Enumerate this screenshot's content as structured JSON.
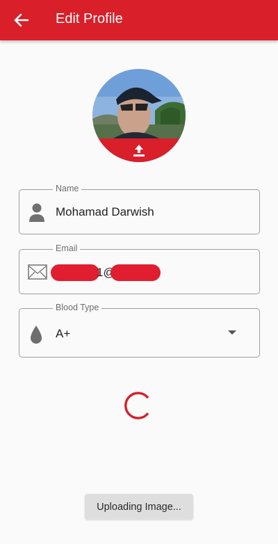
{
  "appbar": {
    "title": "Edit Profile",
    "back_icon": "arrow-back-icon"
  },
  "avatar": {
    "upload_icon": "upload-icon"
  },
  "fields": {
    "name": {
      "label": "Name",
      "value": "Mohamad Darwish",
      "icon": "person-icon"
    },
    "email": {
      "label": "Email",
      "value_visible_part": "1@",
      "icon": "mail-icon"
    },
    "blood_type": {
      "label": "Blood Type",
      "value": "A+",
      "icon": "blood-drop-icon",
      "dropdown_icon": "caret-down-icon"
    }
  },
  "status": {
    "spinner_icon": "loading-spinner"
  },
  "button": {
    "label": "Uploading Image..."
  },
  "colors": {
    "primary": "#d81f2a",
    "background": "#fafafa",
    "button_bg": "#dedede"
  }
}
